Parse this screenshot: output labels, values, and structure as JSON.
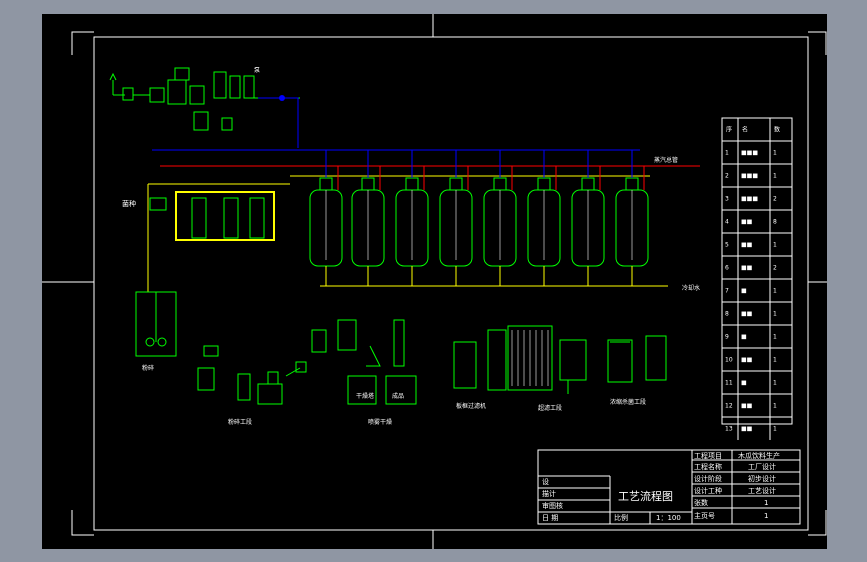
{
  "colors": {
    "outer_bg": "#8f96a3",
    "canvas": "#000000",
    "border": "#ffffff",
    "vessel": "#00ff00",
    "utility_line": "#ffff00",
    "steam_line": "#ff0000",
    "water_line": "#0000ff",
    "label": "#ffffff"
  },
  "title_block": {
    "project_label": "工程项目",
    "project_value": "木瓜饮料生产",
    "name_label": "工程名称",
    "name_value": "工厂设计",
    "stage_label": "设计阶段",
    "stage_value": "初步设计",
    "type_label": "设计工种",
    "type_value": "工艺设计",
    "count_label": "张数",
    "count_value": "1",
    "page_label": "主页号",
    "page_value": "1",
    "design_label": "设",
    "drawing_label": "描计",
    "review_label": "审图核",
    "date_label": "日 期",
    "drawing_title": "工艺流程图",
    "scale_label": "比例",
    "scale_value": "1：100"
  },
  "equipment_table": {
    "headers": [
      "序",
      "名",
      "数"
    ],
    "rows": [
      [
        "1",
        "■■■",
        "1"
      ],
      [
        "2",
        "■■■",
        "1"
      ],
      [
        "3",
        "■■■",
        "2"
      ],
      [
        "4",
        "■■",
        "8"
      ],
      [
        "5",
        "■■",
        "1"
      ],
      [
        "6",
        "■■",
        "2"
      ],
      [
        "7",
        "■",
        "1"
      ],
      [
        "8",
        "■■",
        "1"
      ],
      [
        "9",
        "■",
        "1"
      ],
      [
        "10",
        "■■",
        "1"
      ],
      [
        "11",
        "■",
        "1"
      ],
      [
        "12",
        "■■",
        "1"
      ],
      [
        "13",
        "■■",
        "1"
      ]
    ]
  },
  "diagram_labels": {
    "feed_label": "菌种",
    "steam_label": "蒸汽",
    "red_line_label": "蒸汽总管",
    "right_tank_label": "冷却水",
    "bottom_left_label": "粉碎",
    "stage1": "粉碎工段",
    "stage2": "喷雾干燥",
    "stage3": "超滤工段",
    "stage4": "浓缩杀菌工段",
    "dryer_label": "干燥塔",
    "product_label": "成品",
    "filter_label": "板框过滤机"
  }
}
